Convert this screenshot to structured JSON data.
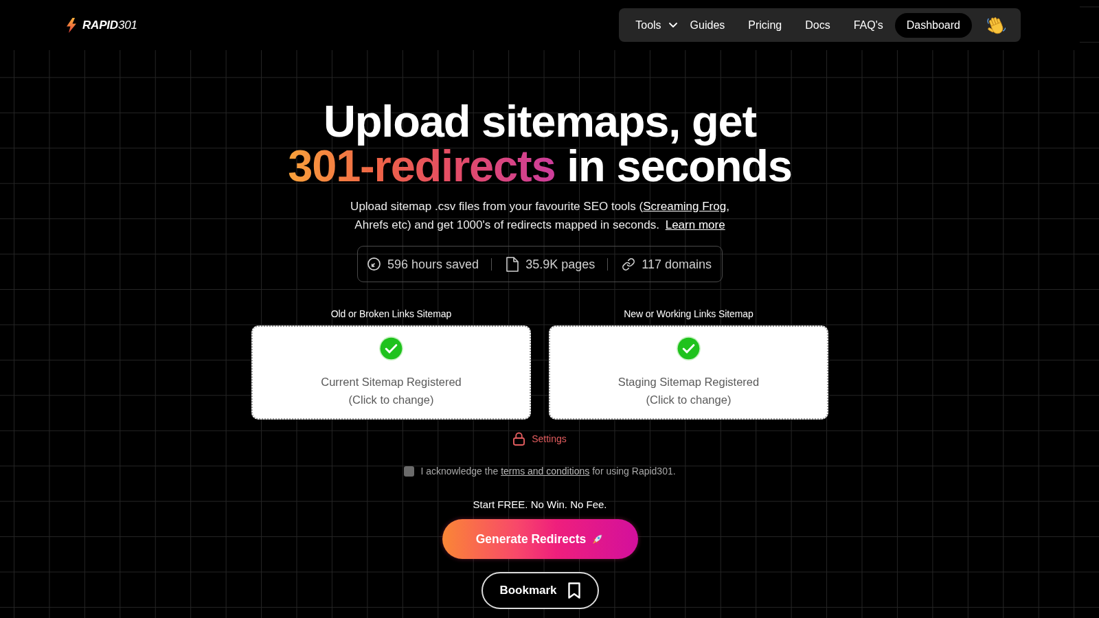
{
  "header": {
    "logo": "**RAPID**301",
    "nav": [
      {
        "label": "Tools",
        "kind": "dropdown"
      },
      {
        "label": "Guides",
        "kind": "link"
      },
      {
        "label": "Pricing",
        "kind": "link"
      },
      {
        "label": "Docs",
        "kind": "link"
      },
      {
        "label": "FAQ's",
        "kind": "link"
      },
      {
        "label": "Dashboard",
        "kind": "button"
      }
    ]
  },
  "hero": {
    "title": {
      "line_1": "Upload sitemaps, get",
      "highlight": "301-redirects",
      "line_2": "in seconds"
    },
    "subtitle": {
      "text_before": "Upload sitemap .csv files from your favourite SEO tools (",
      "link": "Screaming Frog",
      "text_after": ", Ahrefs etc) and get 1000's of redirects mapped in seconds.",
      "learn_more": "Learn more"
    },
    "stats": [
      {
        "kind": "time",
        "text": "596 hours saved"
      },
      {
        "kind": "pages",
        "text": "35.9K pages"
      },
      {
        "kind": "domains",
        "text": "117 domains"
      }
    ]
  },
  "uploads": [
    {
      "label": "Old or Broken Links Sitemap",
      "registered": true,
      "status": "Current Sitemap Registered",
      "hint": "(Click to change)"
    },
    {
      "label": "New or Working Links Sitemap",
      "registered": true,
      "status": "Staging Sitemap Registered",
      "hint": "(Click to change)"
    }
  ],
  "settings": {
    "label": "Settings"
  },
  "terms": {
    "checked": false,
    "text_before": "I acknowledge the",
    "link": "terms and conditions",
    "text_after": "for using Rapid301."
  },
  "tagline": "Start FREE. No Win. No Fee.",
  "generate_button": {
    "label": "Generate Redirects"
  },
  "bookmark_button": {
    "label": "Bookmark"
  }
}
